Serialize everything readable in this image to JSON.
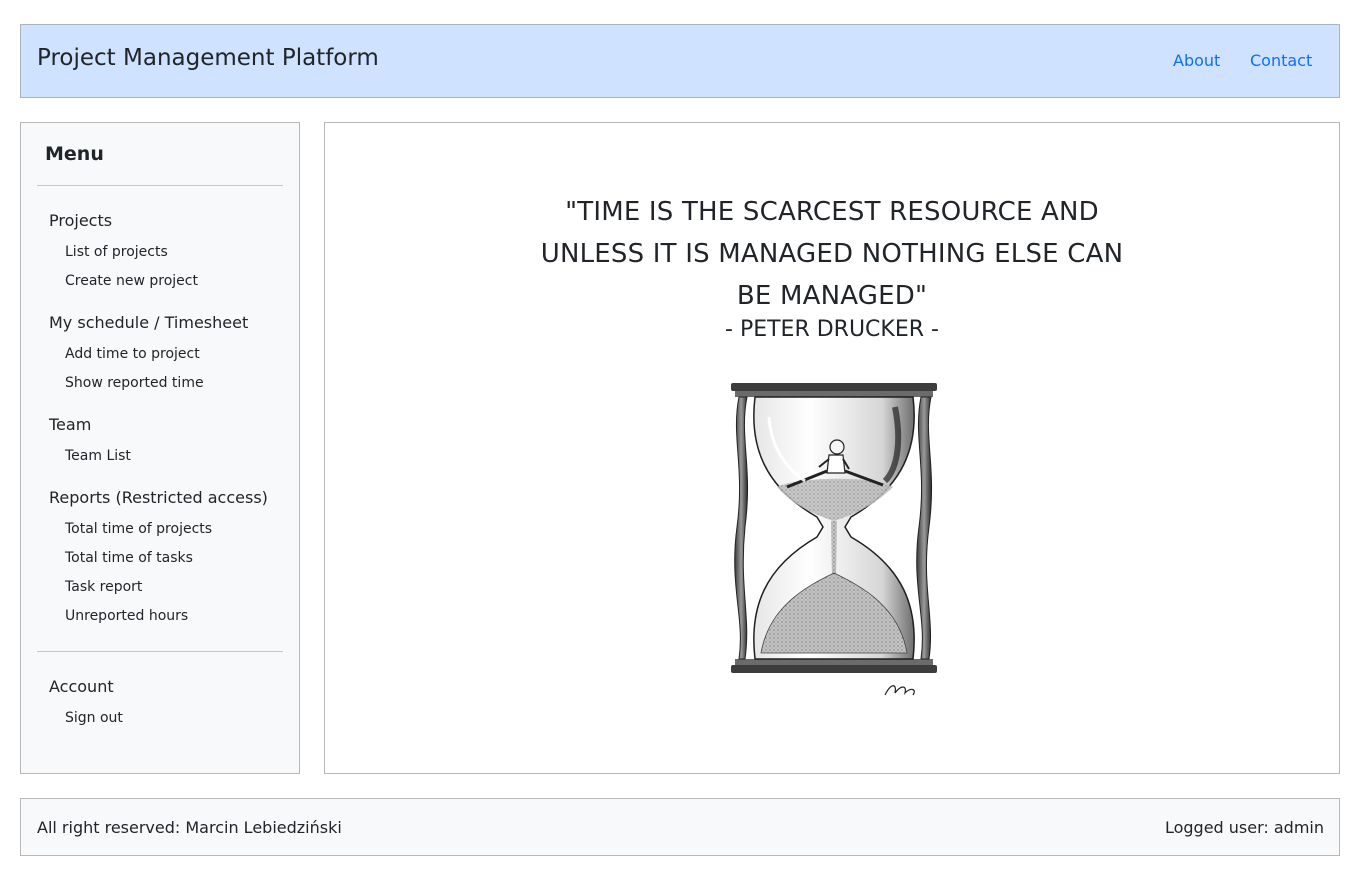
{
  "header": {
    "brand": "Project Management Platform",
    "links": [
      "About",
      "Contact"
    ],
    "bg_color": "#cfe2ff",
    "link_color": "#0d6efd"
  },
  "sidebar": {
    "title": "Menu",
    "sections": [
      {
        "label": "Projects",
        "items": [
          "List of projects",
          "Create new project"
        ]
      },
      {
        "label": "My schedule / Timesheet",
        "items": [
          "Add time to project",
          "Show reported time"
        ]
      },
      {
        "label": "Team",
        "items": [
          "Team List"
        ]
      },
      {
        "label": "Reports (Restricted access)",
        "items": [
          "Total time of projects",
          "Total time of tasks",
          "Task report",
          "Unreported hours"
        ]
      },
      {
        "label": "Account",
        "items": [
          "Sign out"
        ]
      }
    ]
  },
  "main": {
    "quote": "\"TIME IS THE SCARCEST RESOURCE AND UNLESS IT IS MANAGED NOTHING ELSE CAN BE MANAGED\"",
    "author": "- PETER DRUCKER -",
    "image": "hourglass-illustration",
    "signature": "Tolo"
  },
  "footer": {
    "left": "All right reserved: Marcin Lebiedziński",
    "right": "Logged user: admin"
  }
}
